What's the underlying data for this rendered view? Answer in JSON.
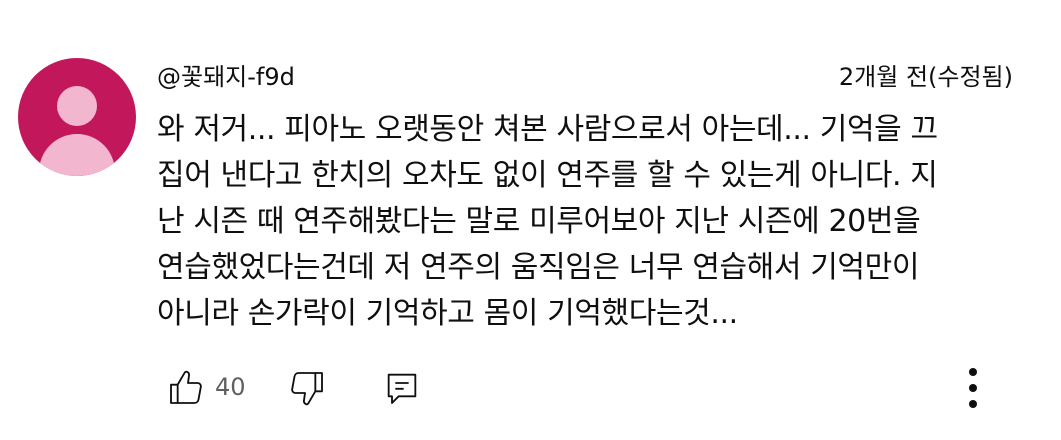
{
  "comment": {
    "author": "@꽃돼지-f9d",
    "timestamp": "2개월 전(수정됨)",
    "text_lines": [
      "와 저거... 피아노 오랫동안 쳐본 사람으로서 아는데... 기억을 끄",
      "집어 낸다고 한치의 오차도 없이 연주를 할 수 있는게 아니다. 지",
      "난 시즌 때 연주해봤다는 말로 미루어보아 지난 시즌에 20번을",
      "연습했었다는건데 저 연주의 움직임은 너무 연습해서 기억만이",
      "아니라 손가락이 기억하고 몸이 기억했다는것..."
    ]
  },
  "actions": {
    "like_count": "40",
    "icons": {
      "like": "thumbs-up-icon",
      "dislike": "thumbs-down-icon",
      "reply": "reply-icon",
      "more": "more-vertical-icon"
    }
  },
  "colors": {
    "avatar_bg": "#c2185b",
    "avatar_fg": "#f3b6cf",
    "text": "#0f0f0f",
    "secondary_text": "#606060"
  }
}
